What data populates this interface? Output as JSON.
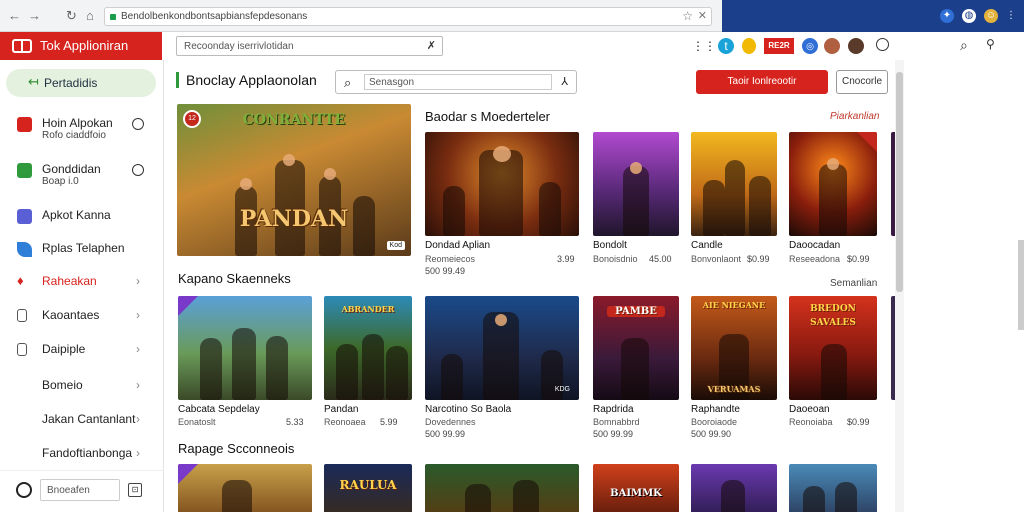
{
  "browser": {
    "address": "Bendolbenkondbontsapbiansfepdesonans",
    "band_color": "#1b3f8a"
  },
  "app": {
    "brand": "Tok Applioniran",
    "brand_color": "#d7231d",
    "top_search_placeholder": "Recoonday iserrivlotidan"
  },
  "topbar_icons": [
    "grid-icon",
    "twitter-icon",
    "flag-icon",
    "app-icon",
    "avatar",
    "user-circle-icon",
    "search-icon",
    "account-icon"
  ],
  "topbar_chip": "RE2R",
  "sidebar": {
    "active": "Pertadidis",
    "items": [
      {
        "label": "Hoin Alpokan",
        "sub": "Rofo ciaddfoio",
        "icon_color": "#d7231d",
        "kind": "radio"
      },
      {
        "label": "Gonddidan",
        "sub": "Boap i.0",
        "icon_color": "#2e9a3c",
        "kind": "radio"
      },
      {
        "label": "Apkot Kanna",
        "sub": "",
        "icon_color": "#5b5fd6",
        "kind": "none"
      },
      {
        "label": "Rplas Telaphen",
        "sub": "",
        "icon_color": "#2f7fd8",
        "kind": "none"
      },
      {
        "label": "Raheakan",
        "sub": "",
        "icon_color": "#d7231d",
        "kind": "chevron"
      },
      {
        "label": "Kaoantaes",
        "sub": "",
        "icon_color": "#555555",
        "kind": "chevron"
      },
      {
        "label": "Daipiple",
        "sub": "",
        "icon_color": "#555555",
        "kind": "chevron"
      },
      {
        "label": "Bomeio",
        "sub": "",
        "icon_color": "",
        "kind": "chevron"
      },
      {
        "label": "Jakan Cantanlant",
        "sub": "",
        "icon_color": "",
        "kind": "chevron"
      },
      {
        "label": "Fandoftianbonga",
        "sub": "",
        "icon_color": "",
        "kind": "chevron"
      }
    ],
    "footer_input": "Bnoeafen"
  },
  "main": {
    "title": "Bnoclay Applaonolan",
    "search_placeholder": "Senasgon",
    "primary_button": "Taoir Ionlreootir",
    "secondary_button": "Cnocorle",
    "featured": {
      "title": "Dondad Aplian",
      "sub": "Reomeiecos",
      "price": "500 99.49",
      "art_text": "PANDAN",
      "art_top": "CONRANTTE",
      "badge": "Kod"
    },
    "sections": [
      {
        "title": "Baodar s Moederteler",
        "link": "Piarkanlian",
        "cards": [
          {
            "title": "Dondad Aplian",
            "sub": "Reomeiecos",
            "price": "500 99.49",
            "badge": "3.99"
          },
          {
            "title": "Bondolt",
            "sub": "Bonoisdnio",
            "price": "45.00",
            "art_text": ""
          },
          {
            "title": "Candle",
            "sub": "Bonvonlaont",
            "price": "$0.99"
          },
          {
            "title": "Daoocadan",
            "sub": "Reseeadona",
            "price": "$0.99"
          }
        ]
      },
      {
        "title": "Kapano Skaenneks",
        "link": "Semanlian",
        "cards": [
          {
            "title": "Cabcata Sepdelay",
            "sub": "Eonatoslt",
            "price": "5.33",
            "art_text": ""
          },
          {
            "title": "Pandan",
            "sub": "Reonoaea",
            "price": "5.99",
            "art_text": "ABRANDER"
          },
          {
            "title": "Narcotino So Baola",
            "sub": "Dovedennes",
            "price": "500 99.99",
            "art_text": "KDG"
          },
          {
            "title": "Rapdrida",
            "sub": "Bomnabbrd",
            "price": "500 99.99",
            "art_text": "PAMBE"
          },
          {
            "title": "Raphandte",
            "sub": "Booroiaode",
            "price": "500 99.90",
            "art_text": "VERUAMAS",
            "art_top": "AIE NIEGANE"
          },
          {
            "title": "Daoeoan",
            "sub": "Reonoiaba",
            "price": "$0.99",
            "art_text": "SAVALES",
            "art_top": "BREDON"
          }
        ]
      },
      {
        "title": "Rapage Scconneois",
        "link": "",
        "cards": [
          {
            "art_text": ""
          },
          {
            "art_text": "RAULUA"
          },
          {
            "art_text": ""
          },
          {
            "art_text": "BAIMMK"
          },
          {
            "art_text": ""
          },
          {
            "art_text": ""
          }
        ]
      }
    ]
  }
}
